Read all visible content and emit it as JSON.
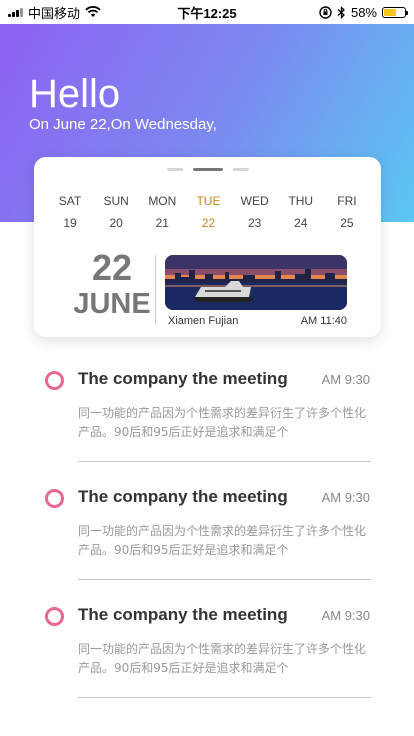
{
  "status_bar": {
    "carrier": "中国移动",
    "time": "下午12:25",
    "battery_text": "58%",
    "battery_level": 0.58,
    "battery_color": "#f5c518"
  },
  "header": {
    "greeting": "Hello",
    "date_line": "On June 22,On Wednesday,",
    "gradient_colors": [
      "#8e62f2",
      "#5bc8f2"
    ]
  },
  "calendar": {
    "week": [
      {
        "name": "SAT",
        "num": "19"
      },
      {
        "name": "SUN",
        "num": "20"
      },
      {
        "name": "MON",
        "num": "21"
      },
      {
        "name": "TUE",
        "num": "22"
      },
      {
        "name": "WED",
        "num": "23"
      },
      {
        "name": "THU",
        "num": "24"
      },
      {
        "name": "FRI",
        "num": "25"
      }
    ],
    "selected_index": 3,
    "highlight_color": "#c7832a",
    "big_day": "22",
    "big_month": "JUNE",
    "location": "Xiamen Fujian",
    "time": "AM 11:40",
    "pager_active_index": 1
  },
  "events": [
    {
      "title": "The company the meeting",
      "time": "AM 9:30",
      "desc": "同一功能的产品因为个性需求的差异衍生了许多个性化产品。90后和95后正好是追求和满足个"
    },
    {
      "title": "The company the meeting",
      "time": "AM 9:30",
      "desc": "同一功能的产品因为个性需求的差异衍生了许多个性化产品。90后和95后正好是追求和满足个"
    },
    {
      "title": "The company the meeting",
      "time": "AM 9:30",
      "desc": "同一功能的产品因为个性需求的差异衍生了许多个性化产品。90后和95后正好是追求和满足个"
    }
  ],
  "icons": {
    "wifi": "wifi-icon",
    "lock_rotation": "rotation-lock-icon",
    "bluetooth": "bluetooth-icon",
    "event_marker": "circle-marker-icon"
  },
  "accent_pink": "#e8688f"
}
